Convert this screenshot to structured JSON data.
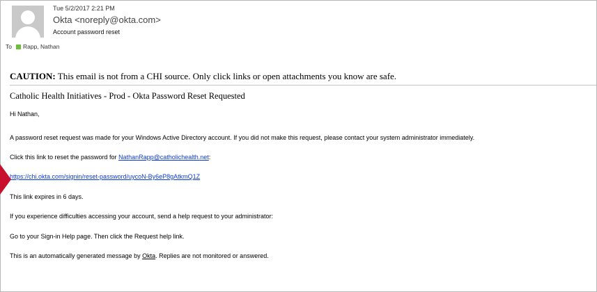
{
  "header": {
    "date": "Tue 5/2/2017 2:21 PM",
    "from": "Okta <noreply@okta.com>",
    "subject": "Account password reset",
    "to_label": "To",
    "to_name": "Rapp, Nathan"
  },
  "caution": {
    "bold": "CAUTION:",
    "text": " This email is not from a CHI source. Only click links or open attachments you know are safe."
  },
  "body": {
    "title": "Catholic Health Initiatives - Prod - Okta Password Reset Requested",
    "greeting": "Hi Nathan,",
    "request_text": "A password reset request was made for your Windows Active Directory account. If you did not make this request, please contact your system administrator immediately.",
    "click_prefix": "Click this link to reset the password for ",
    "email_link": "NathanRapp@catholichealth.net",
    "click_suffix": ":",
    "reset_link": "https://chi.okta.com/signin/reset-password/uycoN-By6eP8gAtkmQ1Z",
    "expires": "This link expires in 6 days.",
    "difficulties": "If you experience difficulties accessing your account, send a help request to your administrator:",
    "signin_help": "Go to your Sign-in Help page. Then click the Request help link.",
    "auto_prefix": "This is an automatically generated message by ",
    "okta_link": "Okta",
    "auto_suffix": ". Replies are not monitored or answered."
  },
  "colors": {
    "link": "#0b3bd6",
    "presence": "#6bbf3a",
    "marker": "#c8102e"
  }
}
